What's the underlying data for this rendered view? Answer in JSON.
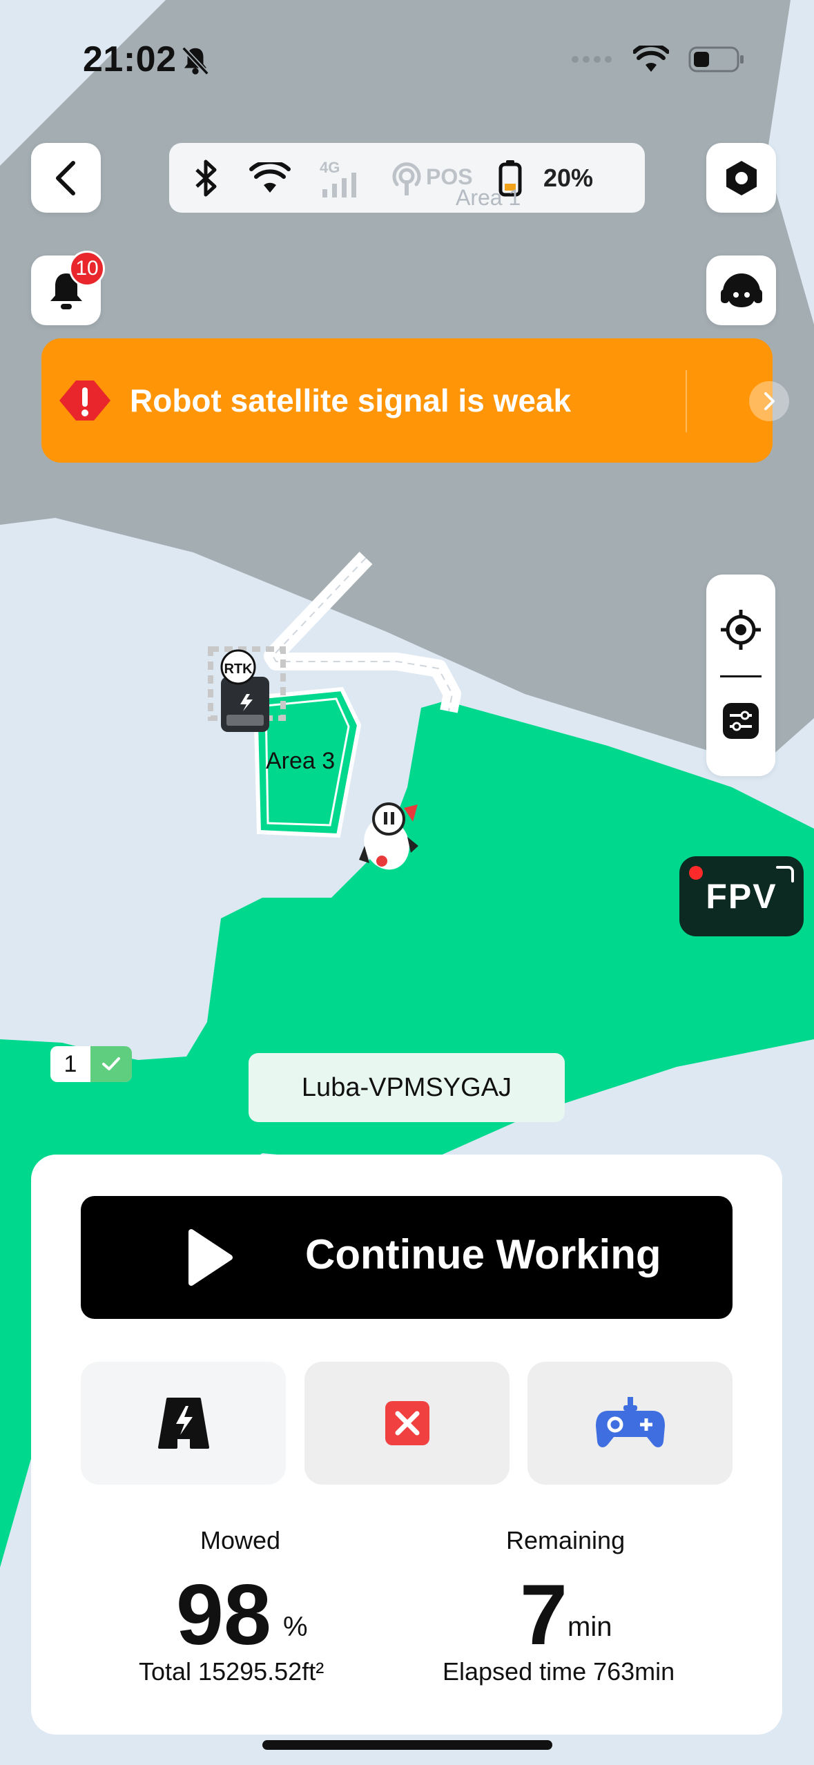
{
  "status_bar": {
    "time": "21:02",
    "battery_icon": "battery-low-icon"
  },
  "top_bar": {
    "back_icon": "chevron-left-icon",
    "connectivity": [
      {
        "name": "bluetooth-icon",
        "active": true
      },
      {
        "name": "wifi-icon",
        "active": true
      },
      {
        "name": "cellular-4g-icon",
        "active": false,
        "label": "4G"
      },
      {
        "name": "pos-icon",
        "active": false,
        "label": "POS"
      }
    ],
    "battery_percent": "20%",
    "settings_icon": "hexagon-settings-icon"
  },
  "map_labels": {
    "area1": "Area 1",
    "area3": "Area 3",
    "rtk": "RTK"
  },
  "notifications": {
    "count": "10"
  },
  "alert": {
    "text": "Robot satellite signal is weak",
    "color": "#ff9507"
  },
  "map_controls": {
    "locate_icon": "crosshair-icon",
    "filter_icon": "sliders-icon"
  },
  "fpv": {
    "label": "FPV"
  },
  "zone_badge": {
    "number": "1"
  },
  "device": {
    "name": "Luba-VPMSYGAJ"
  },
  "panel": {
    "continue_label": "Continue Working",
    "actions": [
      {
        "name": "return-to-charge-icon"
      },
      {
        "name": "stop-icon",
        "color": "#f04040"
      },
      {
        "name": "gamepad-icon",
        "color": "#3f6ee0"
      }
    ],
    "mowed_title": "Mowed",
    "mowed_value": "98",
    "mowed_unit": "%",
    "total_label": "Total 15295.52ft²",
    "remaining_title": "Remaining",
    "remaining_value": "7",
    "remaining_unit": "min",
    "elapsed_label": "Elapsed time 763min"
  },
  "colors": {
    "lawn": "#00d98d",
    "map_gray": "#a3adb2",
    "map_bg": "#dde8f3"
  }
}
